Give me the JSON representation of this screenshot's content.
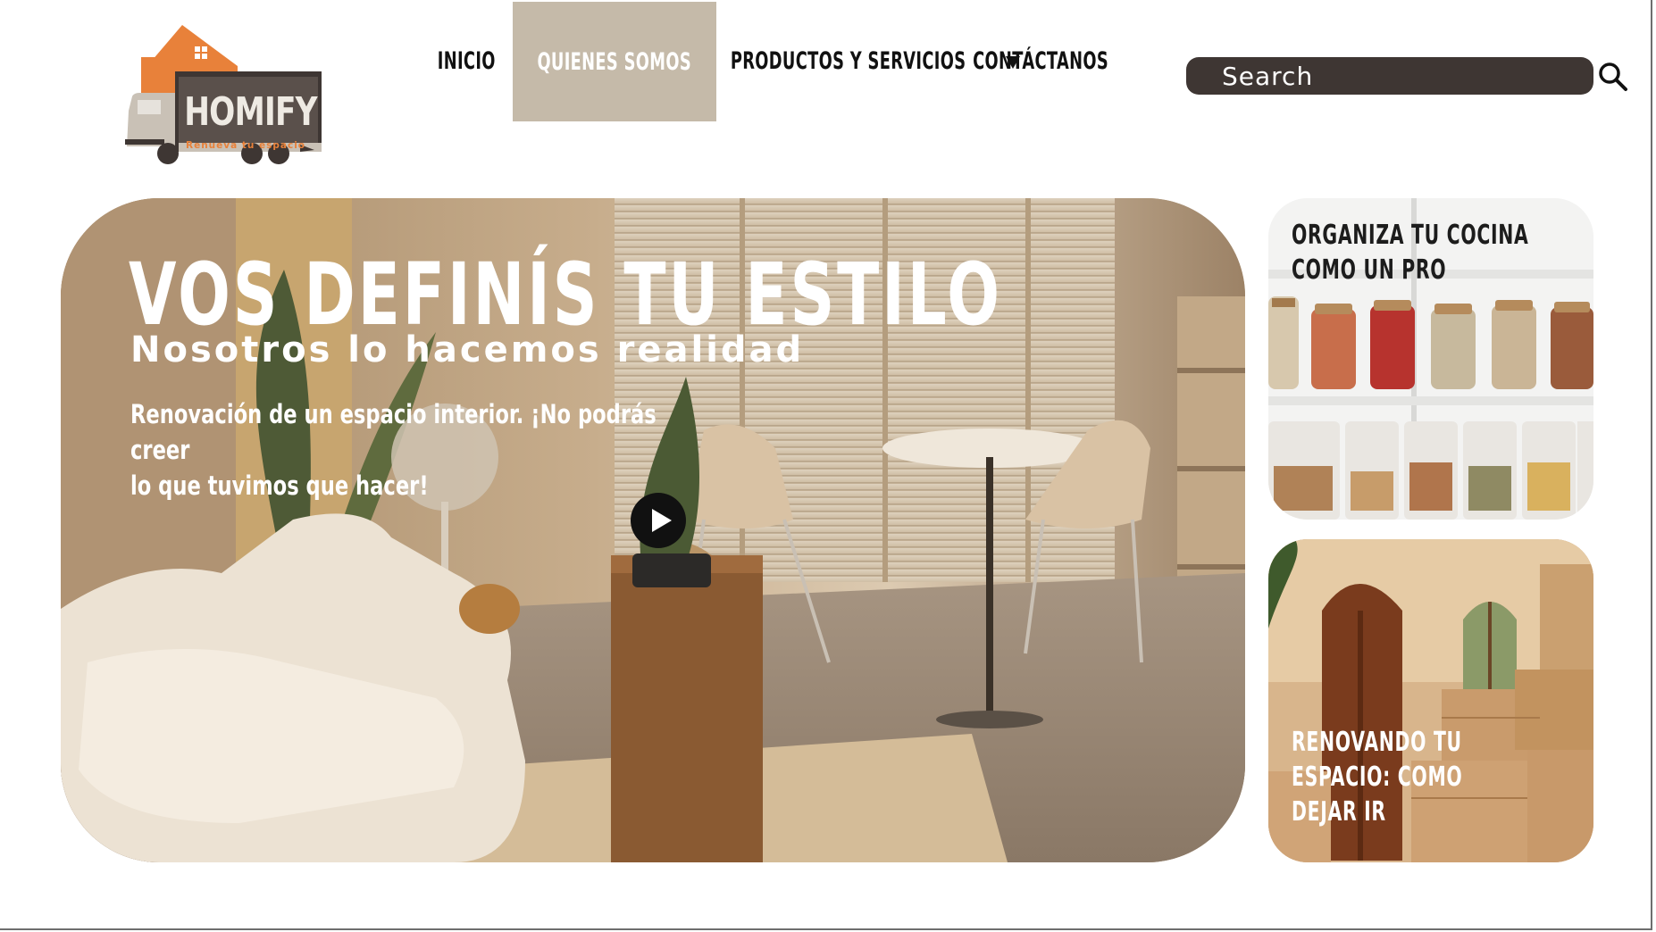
{
  "brand": {
    "name": "HOMIFY",
    "tagline": "Renueva tu espacio"
  },
  "nav": {
    "items": [
      {
        "label": "INICIO"
      },
      {
        "label": "QUIENES SOMOS",
        "active": true
      },
      {
        "label": "PRODUCTOS Y SERVICIOS",
        "has_dropdown": true
      },
      {
        "label": "CONTÁCTANOS"
      }
    ]
  },
  "search": {
    "placeholder": "Search",
    "icon": "search-icon"
  },
  "hero": {
    "title": "VOS DEFINÍS TU ESTILO",
    "subtitle": "Nosotros lo hacemos realidad",
    "description": "Renovación de un espacio interior. ¡No podrás creer\nlo que tuvimos que hacer!",
    "play_icon": "play-icon"
  },
  "cards": [
    {
      "title": "ORGANIZA TU COCINA\nCOMO UN PRO"
    },
    {
      "title": "RENOVANDO TU\nESPACIO: COMO\nDEJAR IR"
    }
  ],
  "colors": {
    "accent_orange": "#e8813a",
    "brand_dark": "#3e3633",
    "nav_active_bg": "#c5baa9",
    "search_bg": "#3e3633"
  }
}
